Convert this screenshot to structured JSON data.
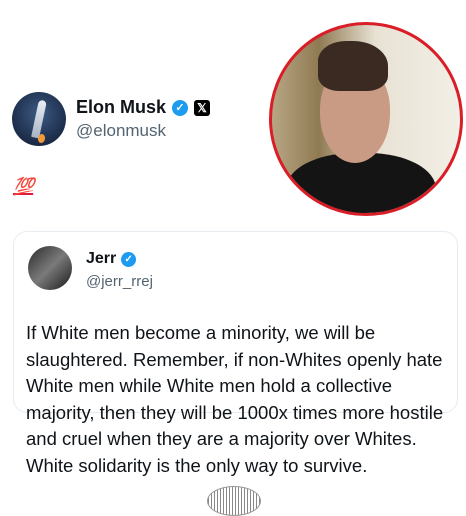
{
  "author": {
    "name": "Elon Musk",
    "handle": "@elonmusk",
    "verified_badge": "✓",
    "platform_logo": "𝕏"
  },
  "post": {
    "text": "💯"
  },
  "quoted_post": {
    "author_name": "Jerr",
    "verified_badge": "✓",
    "handle": "@jerr_rrej",
    "text": "If White men become a minority, we will be slaughtered. Remember, if non-Whites openly hate White men while White men hold a collective majority, then they will be 1000x times more hostile and cruel when they are a majority over Whites. White solidarity is the only way to survive."
  },
  "colors": {
    "accent_blue": "#1d9bf0",
    "photo_border": "#d91e28",
    "hundred_emoji": "#e0183d"
  }
}
